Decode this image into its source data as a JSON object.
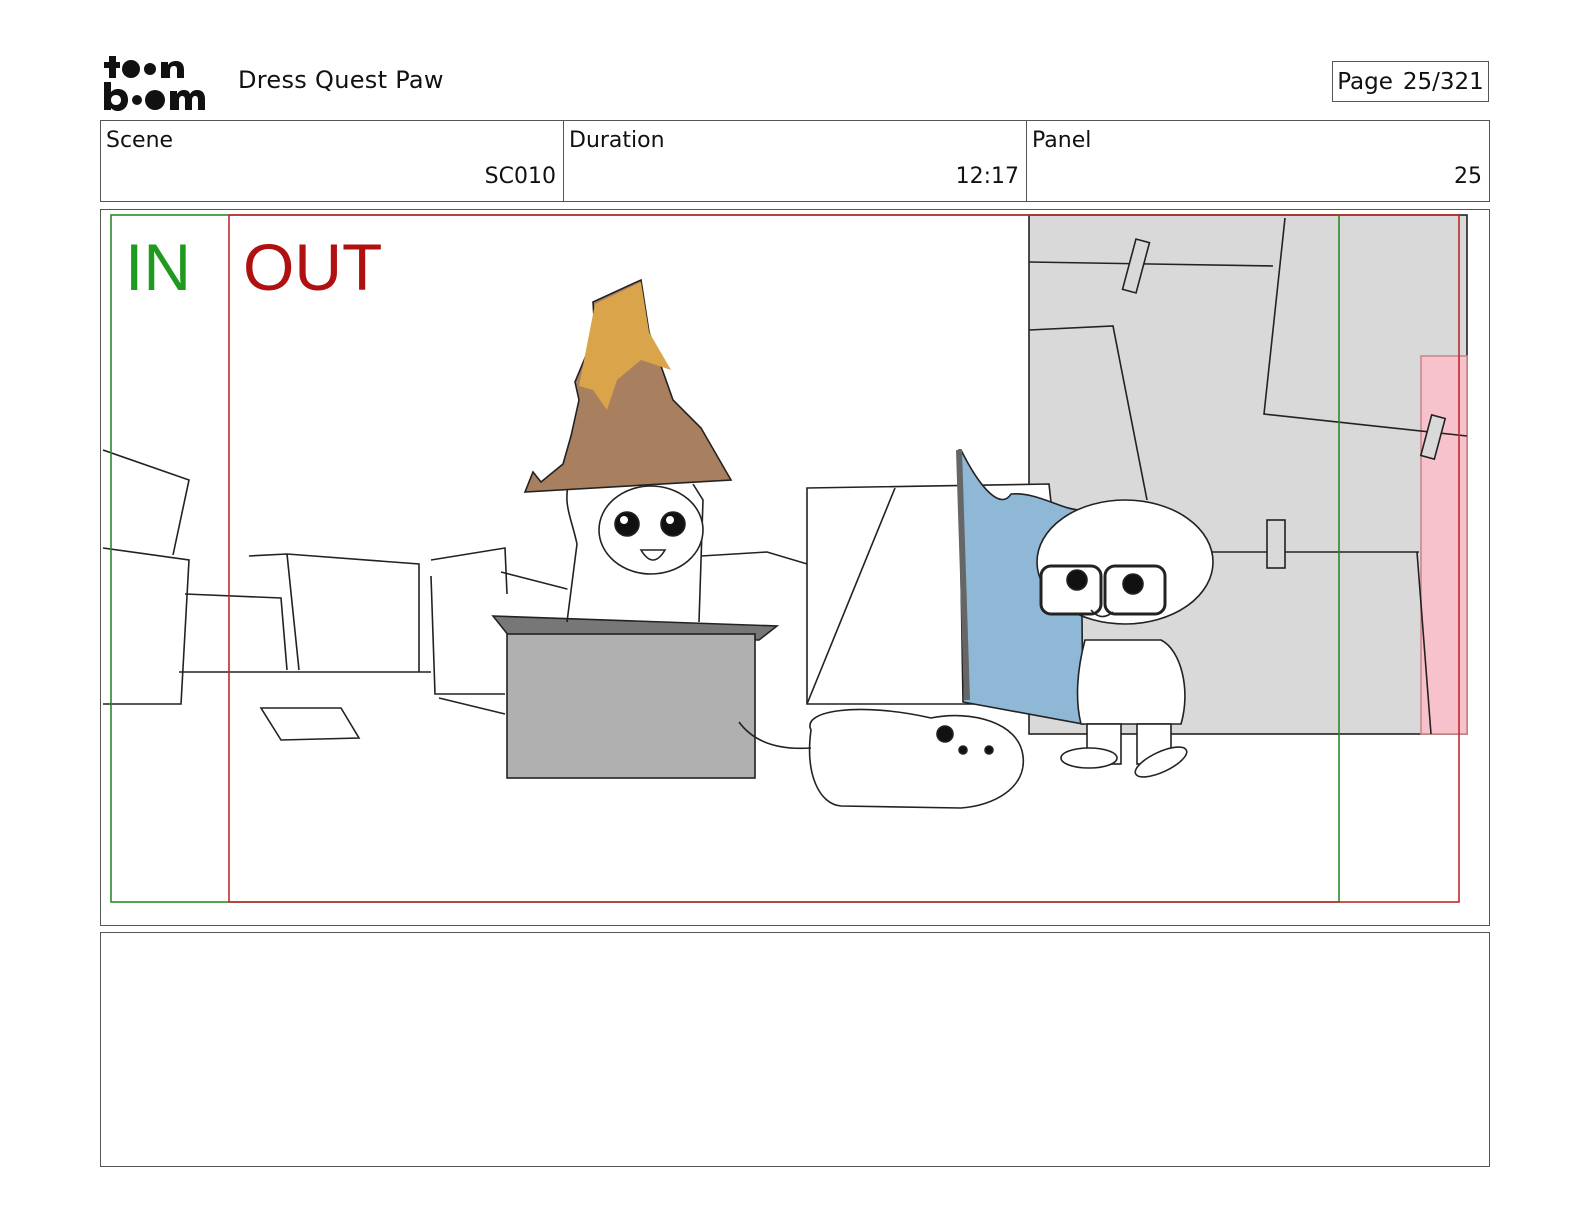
{
  "header": {
    "logo_text_top": "toon",
    "logo_text_bottom": "boom",
    "project_title": "Dress Quest Paw",
    "page_label": "Page",
    "page_value": "25/321"
  },
  "info": {
    "scene_label": "Scene",
    "scene_value": "SC010",
    "duration_label": "Duration",
    "duration_value": "12:17",
    "panel_label": "Panel",
    "panel_value": "25"
  },
  "panel": {
    "in_marker": "IN",
    "out_marker": "OUT",
    "in_color": "#1e9a1e",
    "out_color": "#b01010",
    "illustration": "storyboard-sketch"
  },
  "notes": {
    "text": ""
  }
}
